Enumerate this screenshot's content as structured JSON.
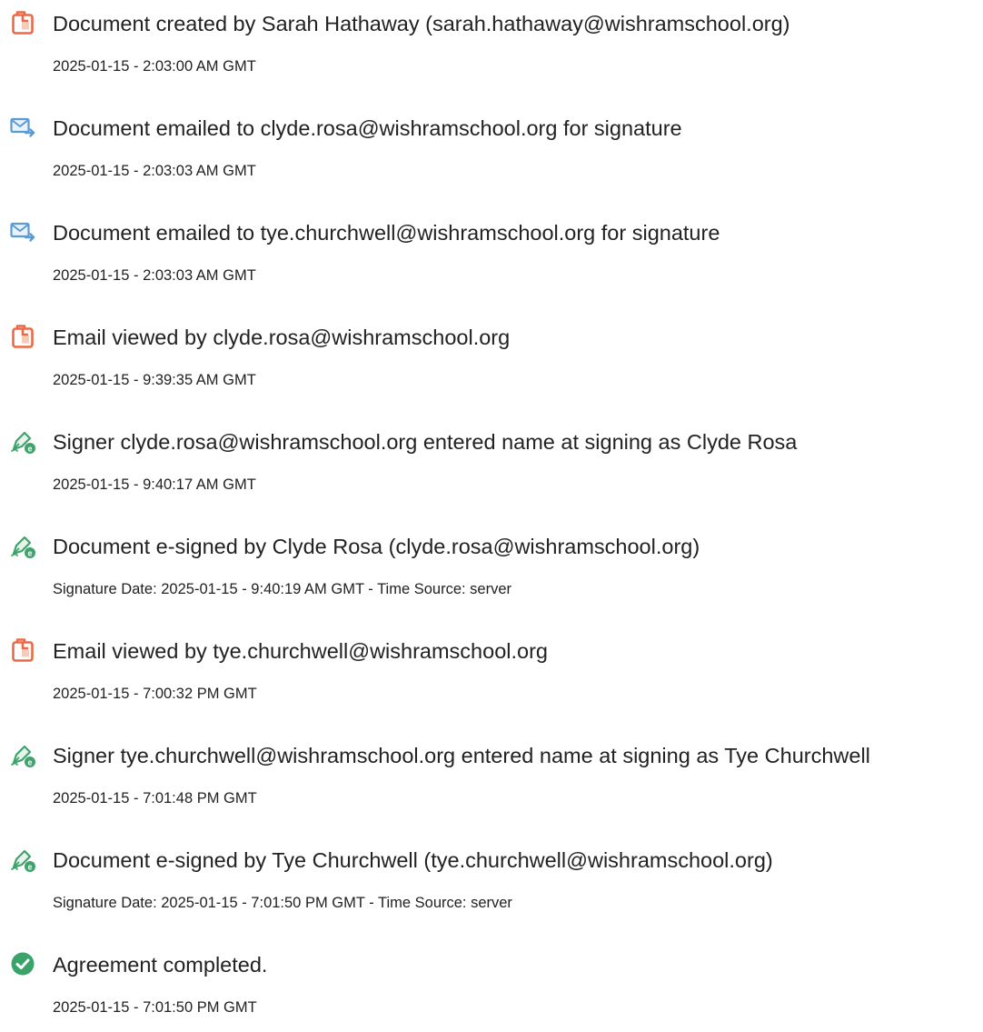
{
  "events": [
    {
      "icon": "document-created-icon",
      "title": "Document created by Sarah Hathaway (sarah.hathaway@wishramschool.org)",
      "date": "2025-01-15 - 2:03:00 AM GMT"
    },
    {
      "icon": "email-sent-icon",
      "title": "Document emailed to clyde.rosa@wishramschool.org for signature",
      "date": "2025-01-15 - 2:03:03 AM GMT"
    },
    {
      "icon": "email-sent-icon",
      "title": "Document emailed to tye.churchwell@wishramschool.org for signature",
      "date": "2025-01-15 - 2:03:03 AM GMT"
    },
    {
      "icon": "document-viewed-icon",
      "title": "Email viewed by clyde.rosa@wishramschool.org",
      "date": "2025-01-15 - 9:39:35 AM GMT"
    },
    {
      "icon": "esign-pen-icon",
      "title": "Signer clyde.rosa@wishramschool.org entered name at signing as Clyde Rosa",
      "date": "2025-01-15 - 9:40:17 AM GMT"
    },
    {
      "icon": "esign-pen-icon",
      "title": "Document e-signed by Clyde Rosa (clyde.rosa@wishramschool.org)",
      "date": "Signature Date: 2025-01-15 - 9:40:19 AM GMT - Time Source: server"
    },
    {
      "icon": "document-viewed-icon",
      "title": "Email viewed by tye.churchwell@wishramschool.org",
      "date": "2025-01-15 - 7:00:32 PM GMT"
    },
    {
      "icon": "esign-pen-icon",
      "title": "Signer tye.churchwell@wishramschool.org entered name at signing as Tye Churchwell",
      "date": "2025-01-15 - 7:01:48 PM GMT"
    },
    {
      "icon": "esign-pen-icon",
      "title": "Document e-signed by Tye Churchwell (tye.churchwell@wishramschool.org)",
      "date": "Signature Date: 2025-01-15 - 7:01:50 PM GMT - Time Source: server"
    },
    {
      "icon": "completed-check-icon",
      "title": "Agreement completed.",
      "date": "2025-01-15 - 7:01:50 PM GMT"
    }
  ],
  "colors": {
    "document_icon": "#EB6A45",
    "email_icon": "#5B9BD5",
    "esign_icon": "#3FA36B",
    "completed_icon": "#3AA36A",
    "text": "#222222"
  }
}
